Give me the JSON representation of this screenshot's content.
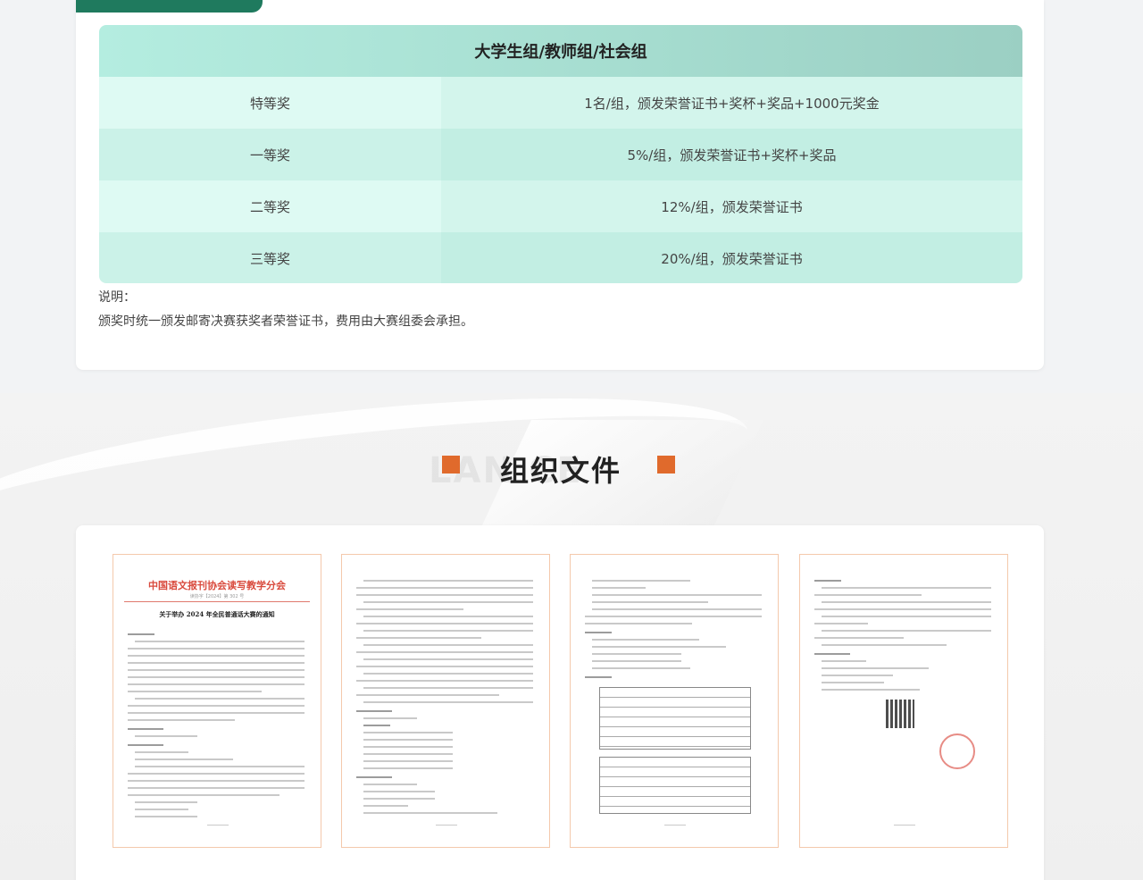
{
  "awards": {
    "header": "大学生组/教师组/社会组",
    "rows": [
      {
        "level": "特等奖",
        "desc": "1名/组，颁发荣誉证书+奖杯+奖品+1000元奖金"
      },
      {
        "level": "一等奖",
        "desc": "5%/组，颁发荣誉证书+奖杯+奖品"
      },
      {
        "level": "二等奖",
        "desc": "12%/组，颁发荣誉证书"
      },
      {
        "level": "三等奖",
        "desc": "20%/组，颁发荣誉证书"
      }
    ],
    "note_label": "说明：",
    "note_text": "颁奖时统一颁发邮寄决赛获奖者荣誉证书，费用由大赛组委会承担。"
  },
  "section": {
    "title": "组织文件",
    "ghost": "LAN  CE"
  },
  "documents": {
    "doc1_org": "中国语文报刊协会读写教学分会",
    "doc1_no": "读协字【2024】第 302 号",
    "doc1_title": "关于举办 2024 年全民普通话大赛的通知"
  },
  "colors": {
    "accent_green": "#1f7a5e",
    "accent_orange": "#e06a2c",
    "doc_border": "#f4c9ac"
  }
}
